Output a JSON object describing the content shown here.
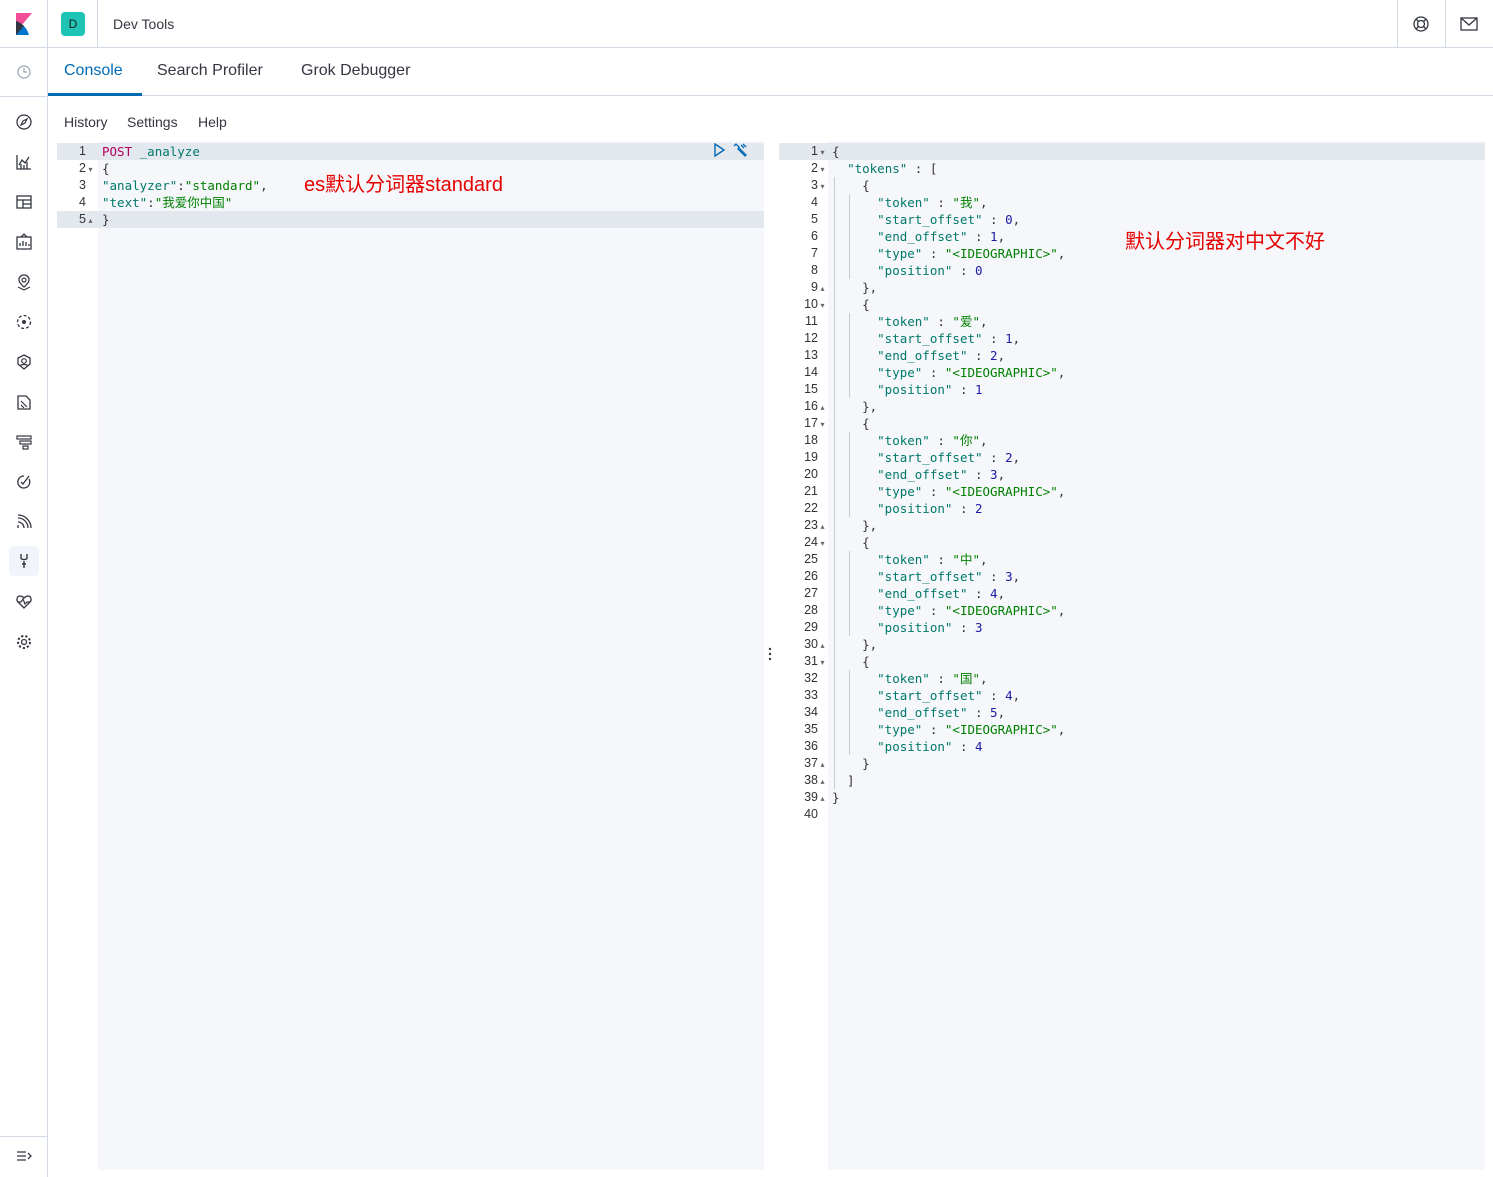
{
  "header": {
    "space_initial": "D",
    "breadcrumb": "Dev Tools"
  },
  "tabs": [
    "Console",
    "Search Profiler",
    "Grok Debugger"
  ],
  "menu": [
    "History",
    "Settings",
    "Help"
  ],
  "request": {
    "lines": [
      {
        "n": "1",
        "fold": "",
        "parts": [
          [
            "k",
            "POST"
          ],
          [
            "p",
            " "
          ],
          [
            "u",
            "_analyze"
          ]
        ]
      },
      {
        "n": "2",
        "fold": "▾",
        "parts": [
          [
            "p",
            "{"
          ]
        ]
      },
      {
        "n": "3",
        "fold": "",
        "parts": [
          [
            "u",
            "\"analyzer\""
          ],
          [
            "p",
            ":"
          ],
          [
            "s",
            "\"standard\""
          ],
          [
            "p",
            ","
          ]
        ]
      },
      {
        "n": "4",
        "fold": "",
        "parts": [
          [
            "u",
            "\"text\""
          ],
          [
            "p",
            ":"
          ],
          [
            "s",
            "\"我爱你中国\""
          ]
        ]
      },
      {
        "n": "5",
        "fold": "▴",
        "parts": [
          [
            "p",
            "}"
          ]
        ]
      }
    ]
  },
  "response": {
    "lines": [
      {
        "n": "1",
        "fold": "▾",
        "parts": [
          [
            "p",
            "{"
          ]
        ]
      },
      {
        "n": "2",
        "fold": "▾",
        "parts": [
          [
            "p",
            "  "
          ],
          [
            "u",
            "\"tokens\""
          ],
          [
            "p",
            " : ["
          ]
        ]
      },
      {
        "n": "3",
        "fold": "▾",
        "parts": [
          [
            "p",
            "    {"
          ]
        ]
      },
      {
        "n": "4",
        "fold": "",
        "parts": [
          [
            "p",
            "      "
          ],
          [
            "u",
            "\"token\""
          ],
          [
            "p",
            " : "
          ],
          [
            "s",
            "\"我\""
          ],
          [
            "p",
            ","
          ]
        ]
      },
      {
        "n": "5",
        "fold": "",
        "parts": [
          [
            "p",
            "      "
          ],
          [
            "u",
            "\"start_offset\""
          ],
          [
            "p",
            " : "
          ],
          [
            "n",
            "0"
          ],
          [
            "p",
            ","
          ]
        ]
      },
      {
        "n": "6",
        "fold": "",
        "parts": [
          [
            "p",
            "      "
          ],
          [
            "u",
            "\"end_offset\""
          ],
          [
            "p",
            " : "
          ],
          [
            "n",
            "1"
          ],
          [
            "p",
            ","
          ]
        ]
      },
      {
        "n": "7",
        "fold": "",
        "parts": [
          [
            "p",
            "      "
          ],
          [
            "u",
            "\"type\""
          ],
          [
            "p",
            " : "
          ],
          [
            "s",
            "\"<IDEOGRAPHIC>\""
          ],
          [
            "p",
            ","
          ]
        ]
      },
      {
        "n": "8",
        "fold": "",
        "parts": [
          [
            "p",
            "      "
          ],
          [
            "u",
            "\"position\""
          ],
          [
            "p",
            " : "
          ],
          [
            "n",
            "0"
          ]
        ]
      },
      {
        "n": "9",
        "fold": "▴",
        "parts": [
          [
            "p",
            "    },"
          ]
        ]
      },
      {
        "n": "10",
        "fold": "▾",
        "parts": [
          [
            "p",
            "    {"
          ]
        ]
      },
      {
        "n": "11",
        "fold": "",
        "parts": [
          [
            "p",
            "      "
          ],
          [
            "u",
            "\"token\""
          ],
          [
            "p",
            " : "
          ],
          [
            "s",
            "\"爱\""
          ],
          [
            "p",
            ","
          ]
        ]
      },
      {
        "n": "12",
        "fold": "",
        "parts": [
          [
            "p",
            "      "
          ],
          [
            "u",
            "\"start_offset\""
          ],
          [
            "p",
            " : "
          ],
          [
            "n",
            "1"
          ],
          [
            "p",
            ","
          ]
        ]
      },
      {
        "n": "13",
        "fold": "",
        "parts": [
          [
            "p",
            "      "
          ],
          [
            "u",
            "\"end_offset\""
          ],
          [
            "p",
            " : "
          ],
          [
            "n",
            "2"
          ],
          [
            "p",
            ","
          ]
        ]
      },
      {
        "n": "14",
        "fold": "",
        "parts": [
          [
            "p",
            "      "
          ],
          [
            "u",
            "\"type\""
          ],
          [
            "p",
            " : "
          ],
          [
            "s",
            "\"<IDEOGRAPHIC>\""
          ],
          [
            "p",
            ","
          ]
        ]
      },
      {
        "n": "15",
        "fold": "",
        "parts": [
          [
            "p",
            "      "
          ],
          [
            "u",
            "\"position\""
          ],
          [
            "p",
            " : "
          ],
          [
            "n",
            "1"
          ]
        ]
      },
      {
        "n": "16",
        "fold": "▴",
        "parts": [
          [
            "p",
            "    },"
          ]
        ]
      },
      {
        "n": "17",
        "fold": "▾",
        "parts": [
          [
            "p",
            "    {"
          ]
        ]
      },
      {
        "n": "18",
        "fold": "",
        "parts": [
          [
            "p",
            "      "
          ],
          [
            "u",
            "\"token\""
          ],
          [
            "p",
            " : "
          ],
          [
            "s",
            "\"你\""
          ],
          [
            "p",
            ","
          ]
        ]
      },
      {
        "n": "19",
        "fold": "",
        "parts": [
          [
            "p",
            "      "
          ],
          [
            "u",
            "\"start_offset\""
          ],
          [
            "p",
            " : "
          ],
          [
            "n",
            "2"
          ],
          [
            "p",
            ","
          ]
        ]
      },
      {
        "n": "20",
        "fold": "",
        "parts": [
          [
            "p",
            "      "
          ],
          [
            "u",
            "\"end_offset\""
          ],
          [
            "p",
            " : "
          ],
          [
            "n",
            "3"
          ],
          [
            "p",
            ","
          ]
        ]
      },
      {
        "n": "21",
        "fold": "",
        "parts": [
          [
            "p",
            "      "
          ],
          [
            "u",
            "\"type\""
          ],
          [
            "p",
            " : "
          ],
          [
            "s",
            "\"<IDEOGRAPHIC>\""
          ],
          [
            "p",
            ","
          ]
        ]
      },
      {
        "n": "22",
        "fold": "",
        "parts": [
          [
            "p",
            "      "
          ],
          [
            "u",
            "\"position\""
          ],
          [
            "p",
            " : "
          ],
          [
            "n",
            "2"
          ]
        ]
      },
      {
        "n": "23",
        "fold": "▴",
        "parts": [
          [
            "p",
            "    },"
          ]
        ]
      },
      {
        "n": "24",
        "fold": "▾",
        "parts": [
          [
            "p",
            "    {"
          ]
        ]
      },
      {
        "n": "25",
        "fold": "",
        "parts": [
          [
            "p",
            "      "
          ],
          [
            "u",
            "\"token\""
          ],
          [
            "p",
            " : "
          ],
          [
            "s",
            "\"中\""
          ],
          [
            "p",
            ","
          ]
        ]
      },
      {
        "n": "26",
        "fold": "",
        "parts": [
          [
            "p",
            "      "
          ],
          [
            "u",
            "\"start_offset\""
          ],
          [
            "p",
            " : "
          ],
          [
            "n",
            "3"
          ],
          [
            "p",
            ","
          ]
        ]
      },
      {
        "n": "27",
        "fold": "",
        "parts": [
          [
            "p",
            "      "
          ],
          [
            "u",
            "\"end_offset\""
          ],
          [
            "p",
            " : "
          ],
          [
            "n",
            "4"
          ],
          [
            "p",
            ","
          ]
        ]
      },
      {
        "n": "28",
        "fold": "",
        "parts": [
          [
            "p",
            "      "
          ],
          [
            "u",
            "\"type\""
          ],
          [
            "p",
            " : "
          ],
          [
            "s",
            "\"<IDEOGRAPHIC>\""
          ],
          [
            "p",
            ","
          ]
        ]
      },
      {
        "n": "29",
        "fold": "",
        "parts": [
          [
            "p",
            "      "
          ],
          [
            "u",
            "\"position\""
          ],
          [
            "p",
            " : "
          ],
          [
            "n",
            "3"
          ]
        ]
      },
      {
        "n": "30",
        "fold": "▴",
        "parts": [
          [
            "p",
            "    },"
          ]
        ]
      },
      {
        "n": "31",
        "fold": "▾",
        "parts": [
          [
            "p",
            "    {"
          ]
        ]
      },
      {
        "n": "32",
        "fold": "",
        "parts": [
          [
            "p",
            "      "
          ],
          [
            "u",
            "\"token\""
          ],
          [
            "p",
            " : "
          ],
          [
            "s",
            "\"国\""
          ],
          [
            "p",
            ","
          ]
        ]
      },
      {
        "n": "33",
        "fold": "",
        "parts": [
          [
            "p",
            "      "
          ],
          [
            "u",
            "\"start_offset\""
          ],
          [
            "p",
            " : "
          ],
          [
            "n",
            "4"
          ],
          [
            "p",
            ","
          ]
        ]
      },
      {
        "n": "34",
        "fold": "",
        "parts": [
          [
            "p",
            "      "
          ],
          [
            "u",
            "\"end_offset\""
          ],
          [
            "p",
            " : "
          ],
          [
            "n",
            "5"
          ],
          [
            "p",
            ","
          ]
        ]
      },
      {
        "n": "35",
        "fold": "",
        "parts": [
          [
            "p",
            "      "
          ],
          [
            "u",
            "\"type\""
          ],
          [
            "p",
            " : "
          ],
          [
            "s",
            "\"<IDEOGRAPHIC>\""
          ],
          [
            "p",
            ","
          ]
        ]
      },
      {
        "n": "36",
        "fold": "",
        "parts": [
          [
            "p",
            "      "
          ],
          [
            "u",
            "\"position\""
          ],
          [
            "p",
            " : "
          ],
          [
            "n",
            "4"
          ]
        ]
      },
      {
        "n": "37",
        "fold": "▴",
        "parts": [
          [
            "p",
            "    }"
          ]
        ]
      },
      {
        "n": "38",
        "fold": "▴",
        "parts": [
          [
            "p",
            "  ]"
          ]
        ]
      },
      {
        "n": "39",
        "fold": "▴",
        "parts": [
          [
            "p",
            "}"
          ]
        ]
      },
      {
        "n": "40",
        "fold": "",
        "parts": []
      }
    ]
  },
  "annotations": {
    "left": "es默认分词器standard",
    "right": "默认分词器对中文不好"
  },
  "colors": {
    "accent": "#006bb4",
    "annotation": "#e60000",
    "keyword": "#b6005d",
    "key": "#00796b",
    "string": "#008000"
  }
}
